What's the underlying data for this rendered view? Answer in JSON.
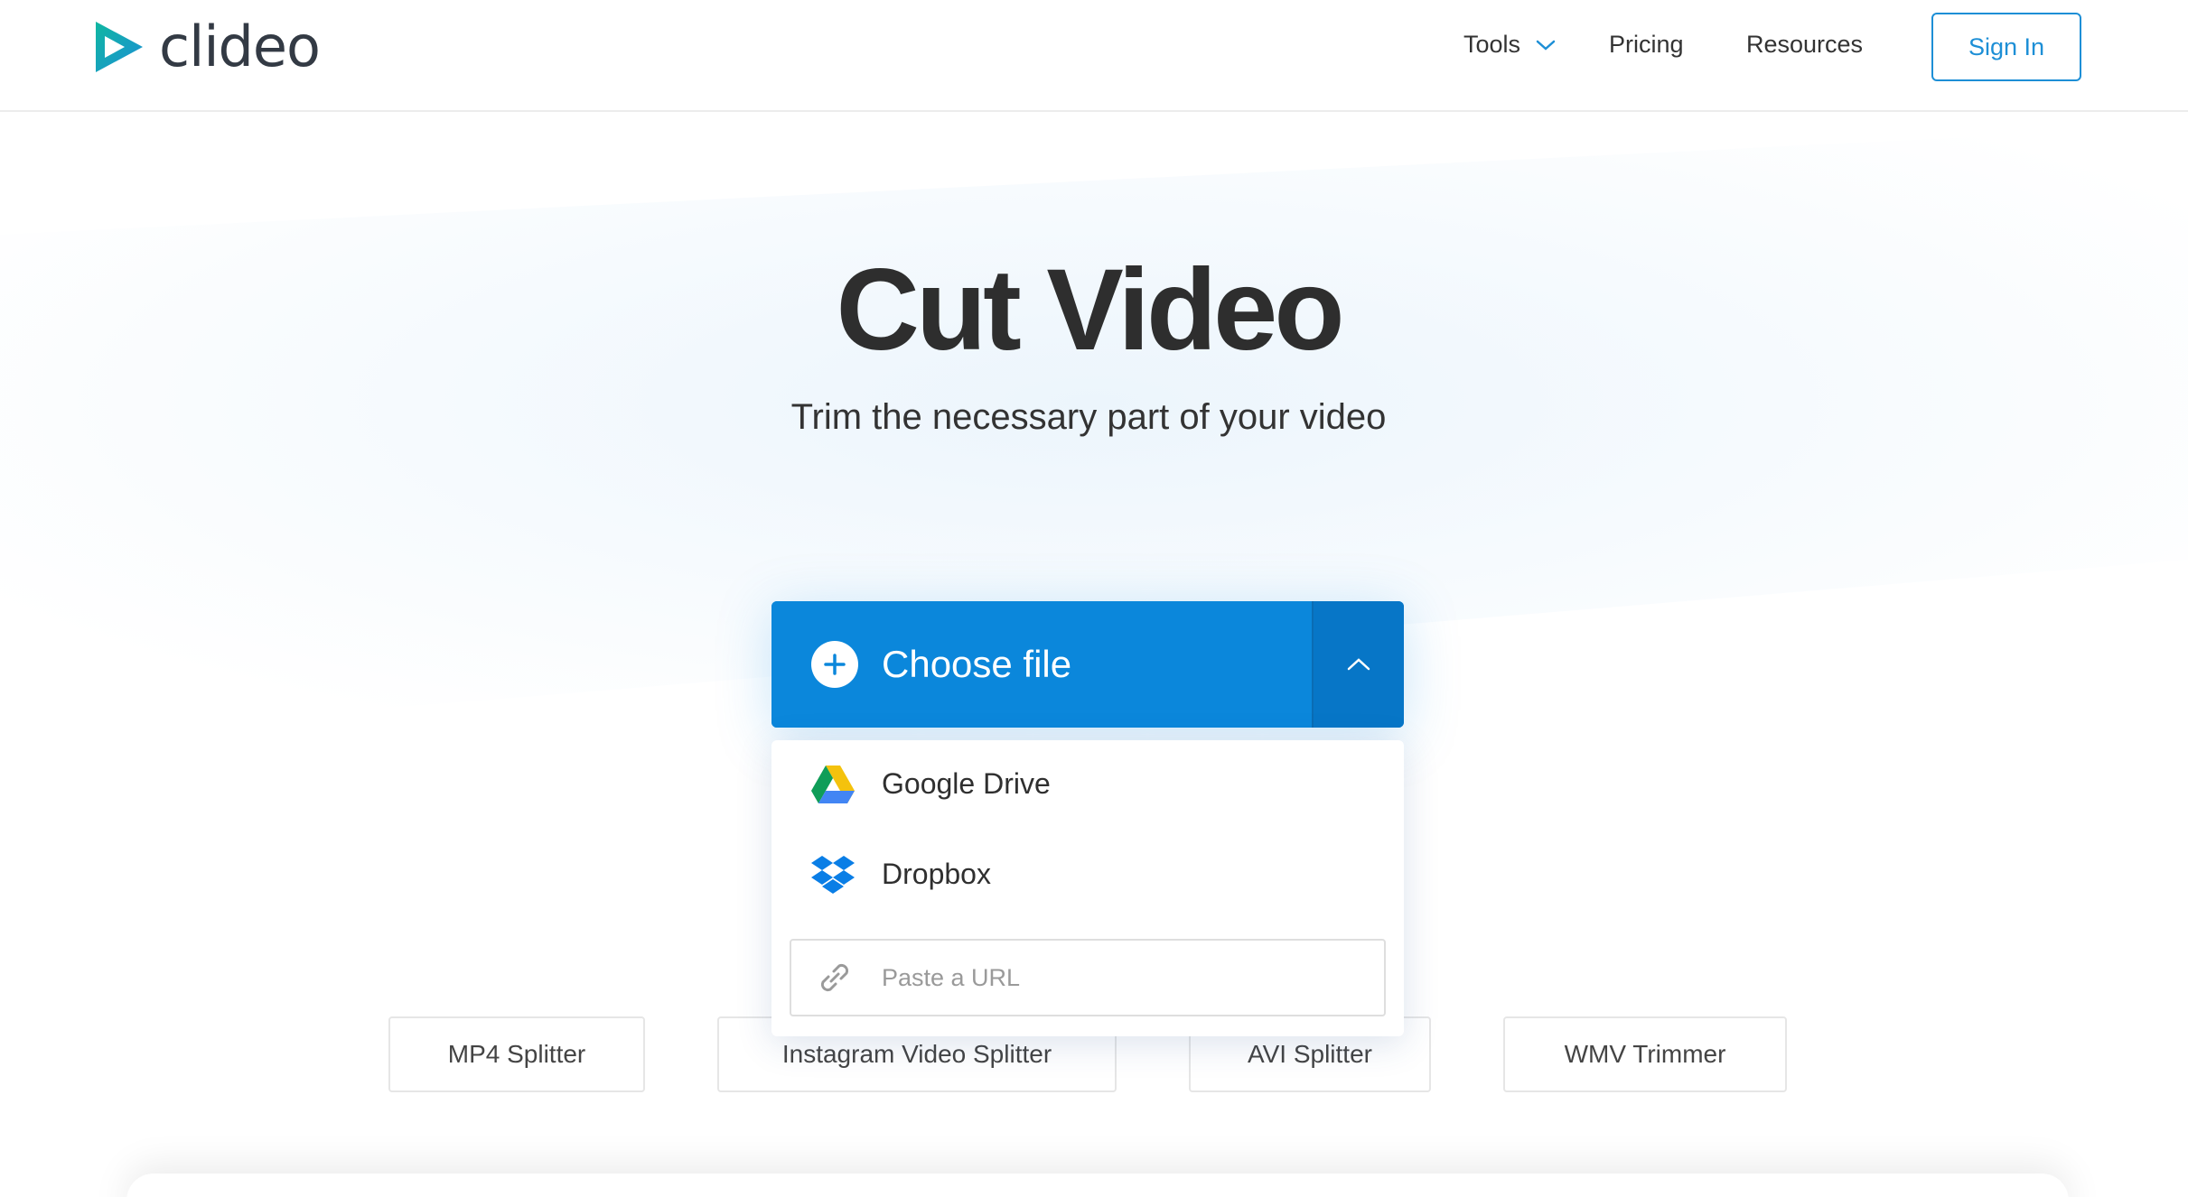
{
  "brand": {
    "name": "clideo",
    "accent": "#1d8fd6",
    "logo_gradient": [
      "#0fb7a1",
      "#1d8fd6"
    ]
  },
  "nav": {
    "tools_label": "Tools",
    "pricing_label": "Pricing",
    "resources_label": "Resources",
    "signin_label": "Sign In"
  },
  "hero": {
    "title": "Cut Video",
    "subtitle": "Trim the necessary part of your video"
  },
  "upload": {
    "choose_label": "Choose file",
    "button_color": "#0b87db",
    "sources": [
      {
        "label": "Google Drive",
        "icon": "google-drive-icon"
      },
      {
        "label": "Dropbox",
        "icon": "dropbox-icon"
      }
    ],
    "url_placeholder": "Paste a URL",
    "url_value": ""
  },
  "related_tools": [
    {
      "label": "MP4 Splitter"
    },
    {
      "label": "Instagram Video Splitter"
    },
    {
      "label": "AVI Splitter"
    },
    {
      "label": "WMV Trimmer"
    }
  ]
}
